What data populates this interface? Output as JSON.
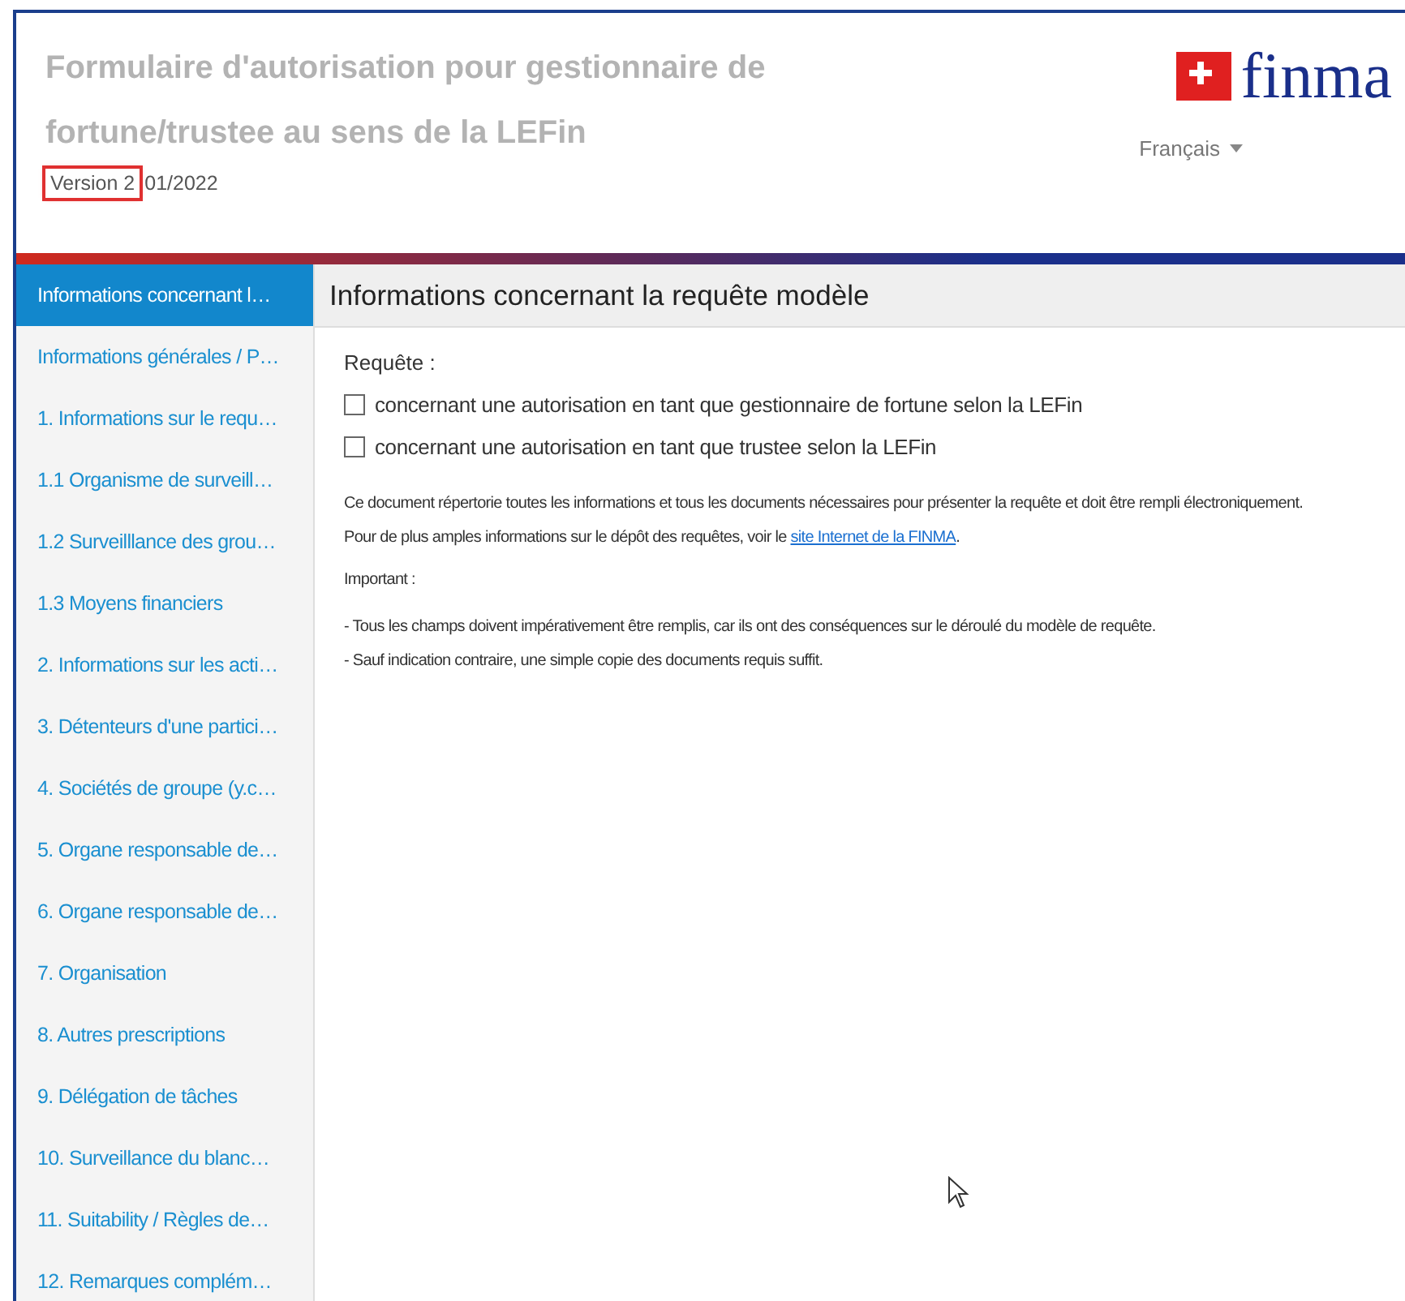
{
  "header": {
    "title_lines": [
      "Formulaire d'autorisation pour gestionnaire de",
      "fortune/trustee au sens de la LEFin"
    ],
    "version": "Version 2",
    "version_highlighted": true,
    "date": "01/2022",
    "logo_text": "finma",
    "language": "Français"
  },
  "sidebar": {
    "items": [
      {
        "label": "Informations concernant l…",
        "selected": true
      },
      {
        "label": "Informations générales / P…",
        "selected": false
      },
      {
        "label": "1. Informations sur le requ…",
        "selected": false
      },
      {
        "label": "1.1 Organisme de surveill…",
        "selected": false
      },
      {
        "label": "1.2 Surveilllance des grou…",
        "selected": false
      },
      {
        "label": "1.3 Moyens financiers",
        "selected": false
      },
      {
        "label": "2. Informations sur les acti…",
        "selected": false
      },
      {
        "label": "3. Détenteurs d'une partici…",
        "selected": false
      },
      {
        "label": "4. Sociétés de groupe (y.c…",
        "selected": false
      },
      {
        "label": "5. Organe responsable de…",
        "selected": false
      },
      {
        "label": "6. Organe responsable de…",
        "selected": false
      },
      {
        "label": "7. Organisation",
        "selected": false
      },
      {
        "label": "8. Autres prescriptions",
        "selected": false
      },
      {
        "label": "9. Délégation de tâches",
        "selected": false
      },
      {
        "label": "10. Surveillance du blanc…",
        "selected": false
      },
      {
        "label": "11. Suitability / Règles de…",
        "selected": false
      },
      {
        "label": "12. Remarques complém…",
        "selected": false
      }
    ]
  },
  "main": {
    "title": "Informations concernant la requête modèle",
    "request_label": "Requête :",
    "options": [
      {
        "label": "concernant une autorisation en tant que gestionnaire de fortune selon la LEFin",
        "checked": false
      },
      {
        "label": "concernant une autorisation en tant que trustee selon la LEFin",
        "checked": false
      }
    ],
    "description": "Ce document répertorie toutes les informations et tous les documents nécessaires pour présenter la requête et doit être rempli électroniquement.",
    "more_info": "Pour de plus amples informations sur le dépôt des requêtes, voir le",
    "link": "site Internet de la FINMA",
    "link_after": ".",
    "important_label": "Important :",
    "notes": [
      "- Tous les champs doivent impérativement être remplis, car ils ont des conséquences sur le déroulé du modèle de requête.",
      "- Sauf indication contraire, une simple copie des documents requis suffit."
    ]
  }
}
